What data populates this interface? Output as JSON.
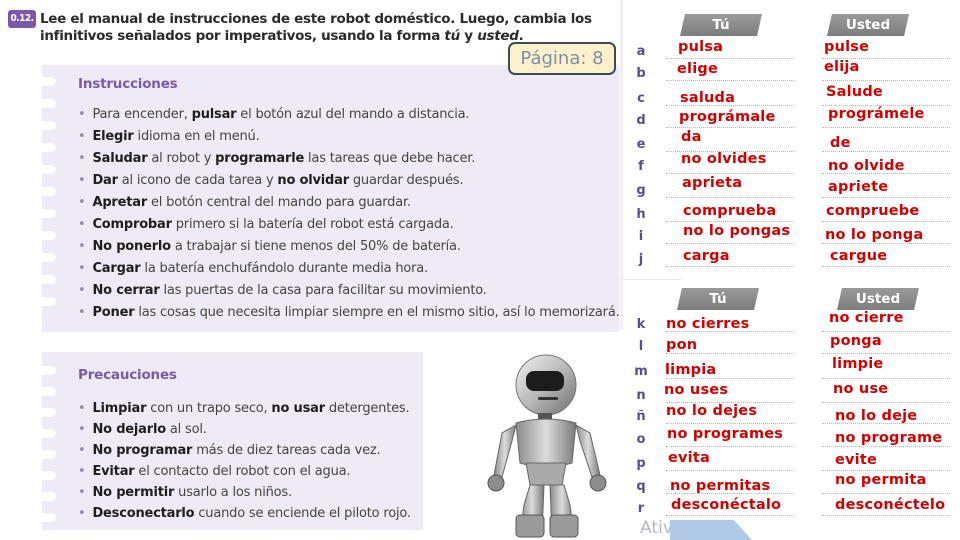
{
  "exercise": {
    "number": "0.12.",
    "title_part1": "Lee el manual de instrucciones de este robot doméstico. Luego, cambia los infinitivos señalados por imperativos, usando la forma ",
    "title_tu": "tú",
    "title_y": " y ",
    "title_usted": "usted",
    "title_end": "."
  },
  "page_tag": "Página: 8",
  "instructions": {
    "heading": "Instrucciones",
    "items": [
      {
        "parts": [
          {
            "t": "Para encender, ",
            "b": false
          },
          {
            "t": "pulsar",
            "b": true
          },
          {
            "t": " el botón azul del mando a distancia.",
            "b": false
          }
        ]
      },
      {
        "parts": [
          {
            "t": "Elegir",
            "b": true
          },
          {
            "t": " idioma en el menú.",
            "b": false
          }
        ]
      },
      {
        "parts": [
          {
            "t": "Saludar",
            "b": true
          },
          {
            "t": " al robot y ",
            "b": false
          },
          {
            "t": "programarle",
            "b": true
          },
          {
            "t": " las tareas que debe hacer.",
            "b": false
          }
        ]
      },
      {
        "parts": [
          {
            "t": "Dar",
            "b": true
          },
          {
            "t": " al icono de cada tarea y ",
            "b": false
          },
          {
            "t": "no olvidar",
            "b": true
          },
          {
            "t": " guardar después.",
            "b": false
          }
        ]
      },
      {
        "parts": [
          {
            "t": "Apretar",
            "b": true
          },
          {
            "t": " el botón central del mando para guardar.",
            "b": false
          }
        ]
      },
      {
        "parts": [
          {
            "t": "Comprobar",
            "b": true
          },
          {
            "t": " primero si la batería del robot está cargada.",
            "b": false
          }
        ]
      },
      {
        "parts": [
          {
            "t": "No ponerlo",
            "b": true
          },
          {
            "t": " a trabajar si tiene menos del 50% de batería.",
            "b": false
          }
        ]
      },
      {
        "parts": [
          {
            "t": "Cargar",
            "b": true
          },
          {
            "t": " la batería enchufándolo durante media hora.",
            "b": false
          }
        ]
      },
      {
        "parts": [
          {
            "t": "No cerrar",
            "b": true
          },
          {
            "t": " las puertas de la casa para facilitar su movimiento.",
            "b": false
          }
        ]
      },
      {
        "parts": [
          {
            "t": "Poner",
            "b": true
          },
          {
            "t": " las cosas que necesita limpiar siempre en el mismo sitio, así lo memorizará.",
            "b": false
          }
        ]
      }
    ]
  },
  "precautions": {
    "heading": "Precauciones",
    "items": [
      {
        "parts": [
          {
            "t": "Limpiar",
            "b": true
          },
          {
            "t": " con un trapo seco, ",
            "b": false
          },
          {
            "t": "no usar",
            "b": true
          },
          {
            "t": " detergentes.",
            "b": false
          }
        ]
      },
      {
        "parts": [
          {
            "t": "No dejarlo",
            "b": true
          },
          {
            "t": " al sol.",
            "b": false
          }
        ]
      },
      {
        "parts": [
          {
            "t": "No programar",
            "b": true
          },
          {
            "t": " más de diez tareas cada vez.",
            "b": false
          }
        ]
      },
      {
        "parts": [
          {
            "t": "Evitar",
            "b": true
          },
          {
            "t": " el contacto del robot con el agua.",
            "b": false
          }
        ]
      },
      {
        "parts": [
          {
            "t": "No permitir",
            "b": true
          },
          {
            "t": " usarlo a los niños.",
            "b": false
          }
        ]
      },
      {
        "parts": [
          {
            "t": "Desconectarlo",
            "b": true
          },
          {
            "t": " cuando se enciende el piloto rojo.",
            "b": false
          }
        ]
      }
    ]
  },
  "answers": {
    "header_tu": "Tú",
    "header_usted": "Usted",
    "group1": [
      {
        "letter": "a",
        "tu": "pulsa",
        "usted": "pulse"
      },
      {
        "letter": "b",
        "tu": "elige",
        "usted": "elija"
      },
      {
        "letter": "c",
        "tu": "saluda",
        "usted": "Salude"
      },
      {
        "letter": "d",
        "tu": "prográmale",
        "usted": "prográmele"
      },
      {
        "letter": "e",
        "tu": "da",
        "usted": "de"
      },
      {
        "letter": "f",
        "tu": "no olvides",
        "usted": "no olvide"
      },
      {
        "letter": "g",
        "tu": "aprieta",
        "usted": "apriete"
      },
      {
        "letter": "h",
        "tu": "comprueba",
        "usted": "compruebe"
      },
      {
        "letter": "i",
        "tu": "no lo pongas",
        "usted": "no lo ponga"
      },
      {
        "letter": "j",
        "tu": "carga",
        "usted": "cargue"
      }
    ],
    "group2": [
      {
        "letter": "k",
        "tu": "no cierres",
        "usted": "no cierre"
      },
      {
        "letter": "l",
        "tu": "pon",
        "usted": "ponga"
      },
      {
        "letter": "m",
        "tu": "limpia",
        "usted": "limpie"
      },
      {
        "letter": "n",
        "tu": "no uses",
        "usted": "no use"
      },
      {
        "letter": "ñ",
        "tu": "no lo dejes",
        "usted": "no lo deje"
      },
      {
        "letter": "o",
        "tu": "no programes",
        "usted": "no programe"
      },
      {
        "letter": "p",
        "tu": "evita",
        "usted": "evite"
      },
      {
        "letter": "q",
        "tu": "no permitas",
        "usted": "no permita"
      },
      {
        "letter": "r",
        "tu": "desconéctalo",
        "usted": "desconéctelo"
      }
    ]
  },
  "watermark": "Ativ",
  "colors": {
    "accent_purple": "#7a5aa8",
    "answer_red": "#d40000",
    "panel_bg": "#eeebf6",
    "page_tag_bg": "#fdf1cc"
  }
}
